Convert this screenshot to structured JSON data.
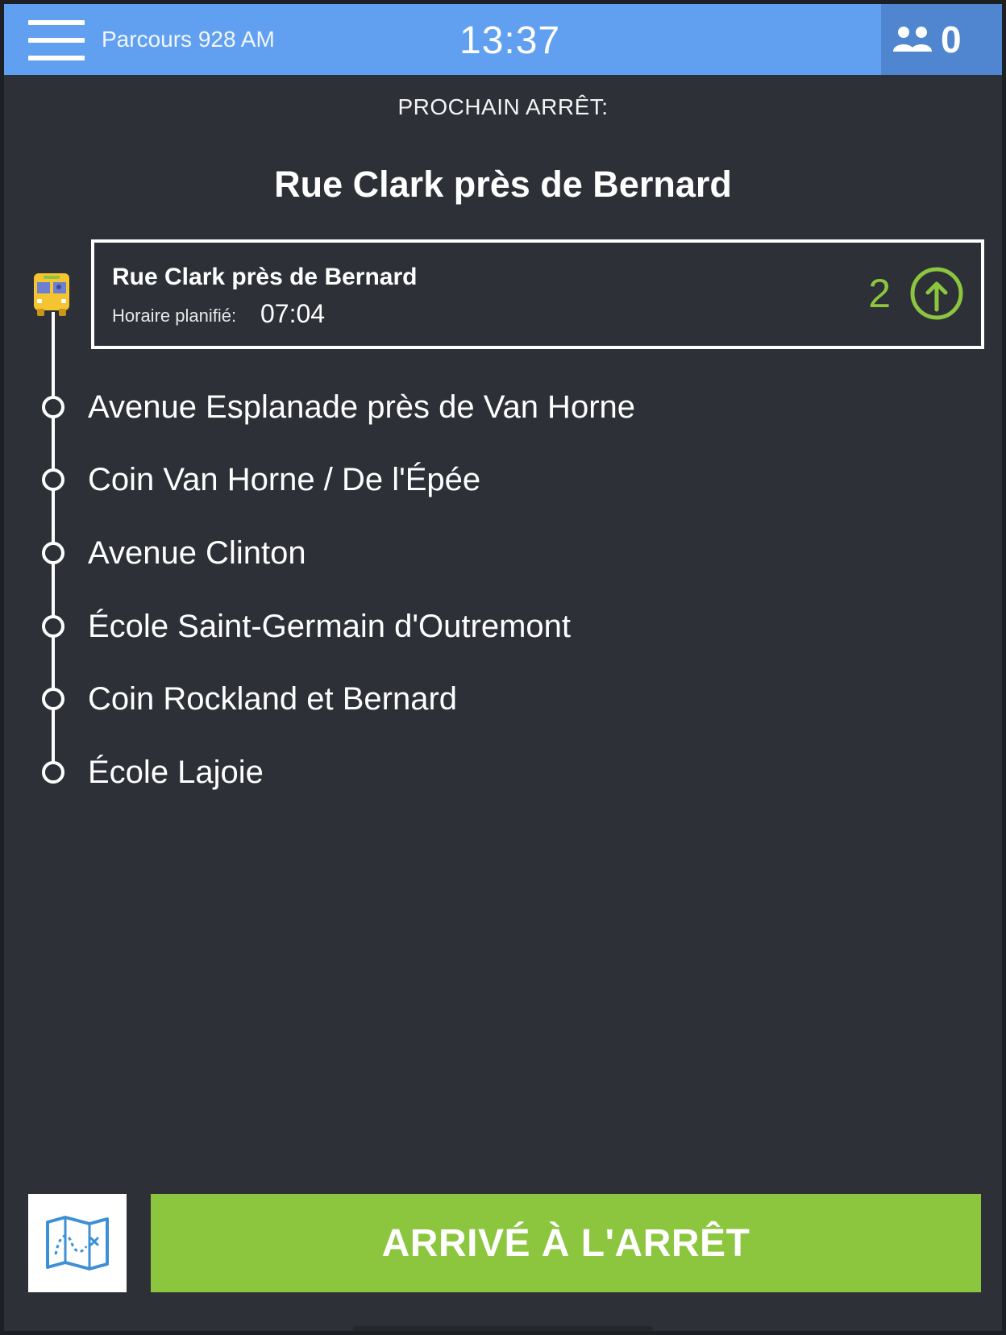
{
  "header": {
    "route_title": "Parcours 928 AM",
    "clock": "13:37",
    "passenger_count": "0"
  },
  "next_stop": {
    "label": "PROCHAIN ARRÊT:",
    "name": "Rue Clark près de Bernard"
  },
  "current_stop": {
    "name": "Rue Clark près de Bernard",
    "scheduled_label": "Horaire planifié:",
    "scheduled_time": "07:04",
    "boarding_count": "2"
  },
  "stops": [
    {
      "name": "Avenue Esplanade près de Van Horne"
    },
    {
      "name": "Coin Van Horne / De l'Épée"
    },
    {
      "name": "Avenue Clinton"
    },
    {
      "name": "École Saint-Germain d'Outremont"
    },
    {
      "name": "Coin Rockland et Bernard"
    },
    {
      "name": "École Lajoie"
    }
  ],
  "actions": {
    "arrive_label": "ARRIVÉ À L'ARRÊT"
  },
  "colors": {
    "header_bg": "#61a0f1",
    "header_counter_bg": "#4f86cf",
    "panel_bg": "#2e3038",
    "accent_green": "#8cc63f",
    "bus_yellow": "#f5c431"
  },
  "icons": {
    "menu": "hamburger-menu-icon",
    "passengers": "users-icon",
    "bus": "school-bus-icon",
    "pickup": "arrow-up-circle-icon",
    "map": "map-icon"
  }
}
